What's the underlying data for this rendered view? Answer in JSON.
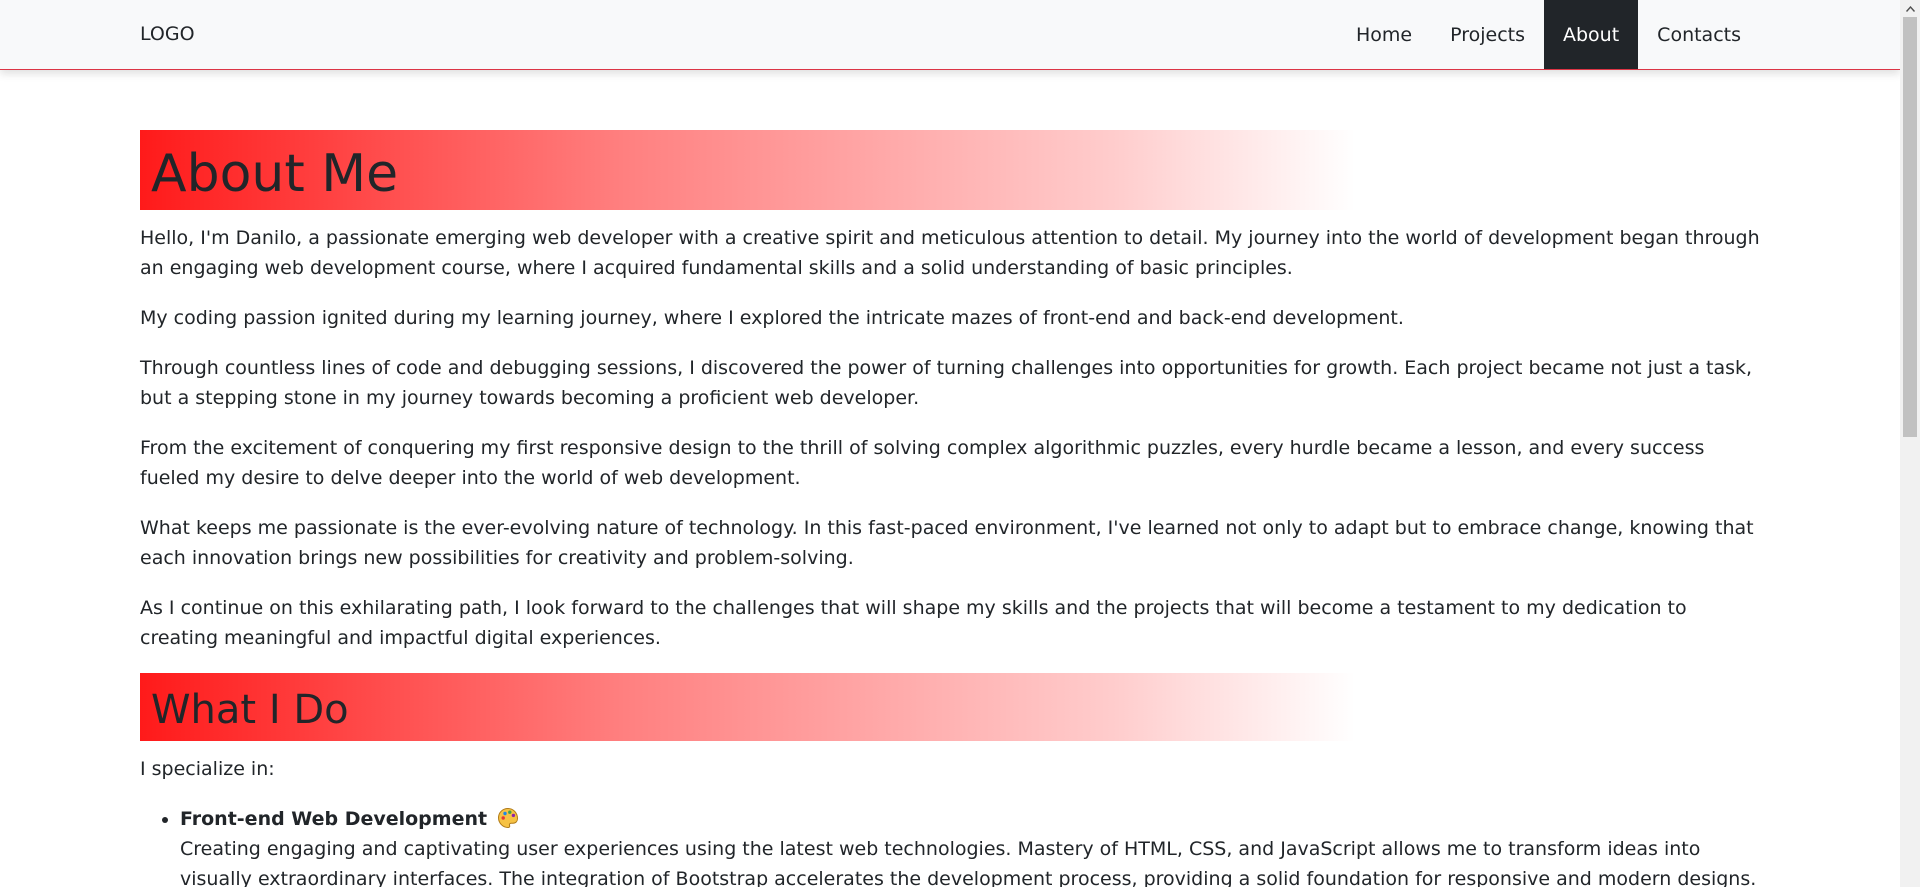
{
  "navbar": {
    "logo": "LOGO",
    "links": [
      "Home",
      "Projects",
      "About",
      "Contacts"
    ],
    "active": "About"
  },
  "about": {
    "heading": "About Me",
    "paragraphs": [
      "Hello, I'm Danilo, a passionate emerging web developer with a creative spirit and meticulous attention to detail. My journey into the world of development began through an engaging web development course, where I acquired fundamental skills and a solid understanding of basic principles.",
      "My coding passion ignited during my learning journey, where I explored the intricate mazes of front-end and back-end development.",
      "Through countless lines of code and debugging sessions, I discovered the power of turning challenges into opportunities for growth. Each project became not just a task, but a stepping stone in my journey towards becoming a proficient web developer.",
      "From the excitement of conquering my first responsive design to the thrill of solving complex algorithmic puzzles, every hurdle became a lesson, and every success fueled my desire to delve deeper into the world of web development.",
      "What keeps me passionate is the ever-evolving nature of technology. In this fast-paced environment, I've learned not only to adapt but to embrace change, knowing that each innovation brings new possibilities for creativity and problem-solving.",
      "As I continue on this exhilarating path, I look forward to the challenges that will shape my skills and the projects that will become a testament to my dedication to creating meaningful and impactful digital experiences."
    ]
  },
  "what_i_do": {
    "heading": "What I Do",
    "intro": "I specialize in:",
    "items": [
      {
        "title": "Front-end Web Development",
        "icon": "palette-icon",
        "description": "Creating engaging and captivating user experiences using the latest web technologies. Mastery of HTML, CSS, and JavaScript allows me to transform ideas into visually extraordinary interfaces. The integration of Bootstrap accelerates the development process, providing a solid foundation for responsive and modern designs. Additionally, Vue.js"
      }
    ]
  },
  "colors": {
    "accent": "#ff1a1a",
    "navbar_bg": "#f8f9fa",
    "active_bg": "#212529",
    "text": "#212529"
  }
}
